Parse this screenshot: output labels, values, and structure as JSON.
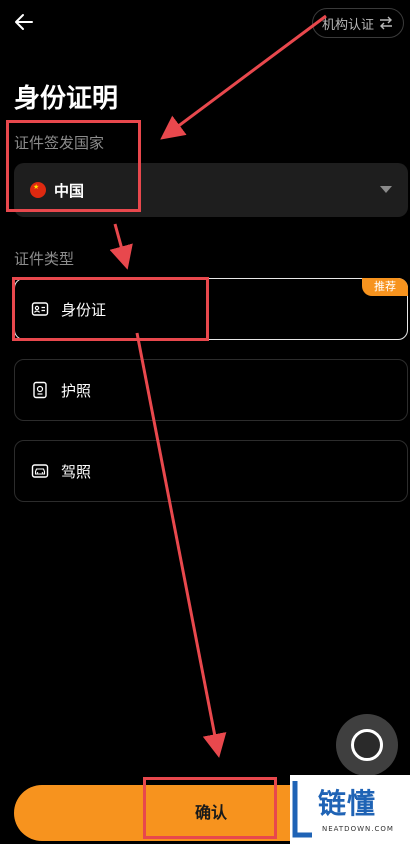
{
  "header": {
    "back_icon": "arrow-left-icon",
    "institution_label": "机构认证",
    "swap_icon": "swap-arrows-icon"
  },
  "title": "身份证明",
  "country_section": {
    "label": "证件签发国家",
    "selected_country": "中国",
    "flag_icon": "china-flag-icon",
    "dropdown_icon": "caret-down-icon"
  },
  "type_section": {
    "label": "证件类型",
    "options": [
      {
        "label": "身份证",
        "icon": "id-card-icon",
        "selected": true,
        "badge": "推荐"
      },
      {
        "label": "护照",
        "icon": "passport-icon",
        "selected": false
      },
      {
        "label": "驾照",
        "icon": "driver-license-icon",
        "selected": false
      }
    ]
  },
  "confirm_button": "确认",
  "floating_button_icon": "assistive-touch-icon",
  "watermark": {
    "brand": "链懂",
    "sub": "NEATDOWN.COM"
  },
  "colors": {
    "accent": "#f7931e",
    "annotation": "#e8484d",
    "watermark_blue": "#1f63b5"
  }
}
